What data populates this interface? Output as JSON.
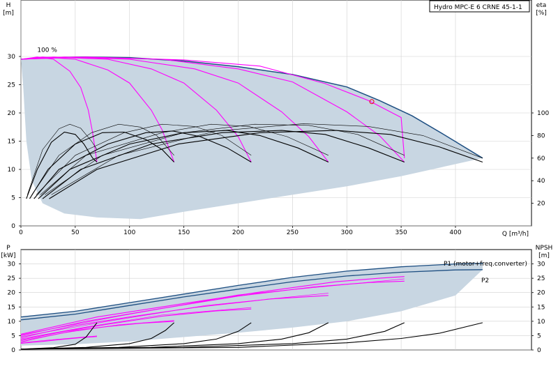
{
  "title": "Hydro MPC-E 6 CRNE 45-1-1",
  "colors": {
    "area_fill": "#c8d6e2",
    "envelope_line": "#1e4f82",
    "magenta": "#ff00ff",
    "black": "#000000",
    "marker": "#e8000b"
  },
  "chart_data": [
    {
      "type": "line",
      "id": "qh-panel",
      "xlabel": "Q [m³/h]",
      "ylabel": "H\n[m]",
      "y2label": "eta\n[%]",
      "xlim": [
        0,
        470
      ],
      "ylim": [
        0,
        40
      ],
      "y2lim": [
        0,
        200
      ],
      "xticks": [
        0,
        50,
        100,
        150,
        200,
        250,
        300,
        350,
        400
      ],
      "yticks": [
        0,
        5,
        10,
        15,
        20,
        25,
        30
      ],
      "y2ticks": [
        20,
        40,
        60,
        80,
        100
      ],
      "grid": true,
      "annotations": [
        {
          "text": "100 %",
          "x": 15,
          "y": 30.8
        }
      ],
      "marker_point": {
        "x": 323,
        "y": 22
      },
      "envelope_upper": [
        [
          0,
          29.5
        ],
        [
          20,
          29.8
        ],
        [
          60,
          29.9
        ],
        [
          100,
          29.8
        ],
        [
          150,
          29.2
        ],
        [
          200,
          28.2
        ],
        [
          250,
          26.8
        ],
        [
          300,
          24.6
        ],
        [
          330,
          22.2
        ],
        [
          360,
          19.5
        ],
        [
          390,
          16.1
        ],
        [
          425,
          12.0
        ]
      ],
      "envelope_lower_area": [
        [
          0,
          29.5
        ],
        [
          2,
          25
        ],
        [
          5,
          15
        ],
        [
          10,
          8
        ],
        [
          20,
          4
        ],
        [
          40,
          2.2
        ],
        [
          70,
          1.5
        ],
        [
          110,
          1.2
        ],
        [
          150,
          2.5
        ],
        [
          200,
          4
        ],
        [
          250,
          5.5
        ],
        [
          300,
          7
        ],
        [
          350,
          8.8
        ],
        [
          425,
          12.0
        ]
      ],
      "envelope_lower_h": [
        [
          0,
          29.5
        ],
        [
          15,
          30.0
        ],
        [
          60,
          29.9
        ],
        [
          100,
          29.7
        ],
        [
          150,
          29.0
        ],
        [
          200,
          27.8
        ],
        [
          250,
          26.2
        ],
        [
          300,
          23.8
        ],
        [
          350,
          20.2
        ],
        [
          390,
          16.0
        ],
        [
          425,
          11.8
        ]
      ],
      "head_curves": [
        [
          [
            0,
            29.5
          ],
          [
            15,
            29.9
          ],
          [
            30,
            29.5
          ],
          [
            45,
            27.4
          ],
          [
            55,
            24.5
          ],
          [
            62,
            20.5
          ],
          [
            66,
            16.5
          ],
          [
            70,
            11.3
          ]
        ],
        [
          [
            0,
            29.5
          ],
          [
            20,
            29.9
          ],
          [
            50,
            29.5
          ],
          [
            80,
            27.6
          ],
          [
            100,
            25.3
          ],
          [
            120,
            20.5
          ],
          [
            130,
            17.0
          ],
          [
            141,
            11.3
          ]
        ],
        [
          [
            0,
            29.5
          ],
          [
            30,
            29.9
          ],
          [
            80,
            29.5
          ],
          [
            120,
            27.8
          ],
          [
            150,
            25.3
          ],
          [
            180,
            20.5
          ],
          [
            200,
            15.8
          ],
          [
            212,
            11.3
          ]
        ],
        [
          [
            0,
            29.5
          ],
          [
            40,
            29.9
          ],
          [
            100,
            29.5
          ],
          [
            160,
            27.8
          ],
          [
            200,
            25.3
          ],
          [
            240,
            20.2
          ],
          [
            265,
            15.8
          ],
          [
            283,
            11.3
          ]
        ],
        [
          [
            0,
            29.5
          ],
          [
            50,
            29.9
          ],
          [
            130,
            29.5
          ],
          [
            200,
            27.8
          ],
          [
            250,
            25.5
          ],
          [
            300,
            20.2
          ],
          [
            330,
            16.0
          ],
          [
            353,
            11.3
          ]
        ],
        [
          [
            0,
            29.5
          ],
          [
            60,
            29.9
          ],
          [
            150,
            29.4
          ],
          [
            220,
            28.3
          ],
          [
            280,
            25.2
          ],
          [
            320,
            22.2
          ],
          [
            350,
            19.2
          ],
          [
            353,
            12.0
          ]
        ]
      ],
      "eta_curves": [
        [
          [
            5,
            4.8
          ],
          [
            15,
            10.0
          ],
          [
            28,
            14.8
          ],
          [
            40,
            16.6
          ],
          [
            50,
            16.2
          ],
          [
            58,
            14.5
          ],
          [
            66,
            12.0
          ],
          [
            70,
            11.3
          ]
        ],
        [
          [
            8,
            4.8
          ],
          [
            25,
            10.0
          ],
          [
            50,
            14.5
          ],
          [
            75,
            16.5
          ],
          [
            95,
            16.6
          ],
          [
            115,
            15.3
          ],
          [
            130,
            13.5
          ],
          [
            141,
            11.3
          ]
        ],
        [
          [
            12,
            4.8
          ],
          [
            35,
            10.0
          ],
          [
            80,
            14.5
          ],
          [
            115,
            16.5
          ],
          [
            140,
            16.8
          ],
          [
            165,
            15.8
          ],
          [
            190,
            13.8
          ],
          [
            212,
            11.3
          ]
        ],
        [
          [
            16,
            4.8
          ],
          [
            45,
            10.0
          ],
          [
            100,
            14.5
          ],
          [
            150,
            16.5
          ],
          [
            190,
            16.9
          ],
          [
            220,
            16.0
          ],
          [
            255,
            13.8
          ],
          [
            283,
            11.3
          ]
        ],
        [
          [
            20,
            4.8
          ],
          [
            55,
            10.0
          ],
          [
            120,
            14.5
          ],
          [
            185,
            16.5
          ],
          [
            240,
            16.9
          ],
          [
            280,
            16.2
          ],
          [
            320,
            13.8
          ],
          [
            353,
            11.3
          ]
        ],
        [
          [
            26,
            4.8
          ],
          [
            70,
            10.0
          ],
          [
            145,
            14.5
          ],
          [
            220,
            16.5
          ],
          [
            290,
            16.9
          ],
          [
            340,
            16.2
          ],
          [
            385,
            14.0
          ],
          [
            425,
            11.3
          ]
        ]
      ],
      "eta_thin_curves": [
        [
          [
            6,
            5.5
          ],
          [
            20,
            13.5
          ],
          [
            35,
            17.2
          ],
          [
            45,
            18.0
          ],
          [
            55,
            17.3
          ],
          [
            65,
            15.0
          ],
          [
            70,
            13.5
          ]
        ],
        [
          [
            10,
            5.5
          ],
          [
            35,
            12.5
          ],
          [
            65,
            16.5
          ],
          [
            90,
            18.0
          ],
          [
            110,
            17.5
          ],
          [
            125,
            16.0
          ],
          [
            141,
            12.5
          ]
        ],
        [
          [
            14,
            5.5
          ],
          [
            50,
            12.5
          ],
          [
            95,
            16.5
          ],
          [
            130,
            18.0
          ],
          [
            160,
            17.6
          ],
          [
            185,
            16.0
          ],
          [
            212,
            12.5
          ]
        ],
        [
          [
            18,
            5.5
          ],
          [
            60,
            12.5
          ],
          [
            130,
            16.5
          ],
          [
            175,
            18.0
          ],
          [
            210,
            17.6
          ],
          [
            245,
            15.8
          ],
          [
            283,
            12.5
          ]
        ],
        [
          [
            22,
            5.5
          ],
          [
            75,
            12.5
          ],
          [
            150,
            16.5
          ],
          [
            215,
            18.0
          ],
          [
            265,
            17.8
          ],
          [
            310,
            16.2
          ],
          [
            353,
            12.5
          ]
        ],
        [
          [
            28,
            5.5
          ],
          [
            90,
            12.5
          ],
          [
            180,
            16.8
          ],
          [
            260,
            18.1
          ],
          [
            320,
            17.6
          ],
          [
            370,
            16.0
          ],
          [
            425,
            12.0
          ]
        ]
      ]
    },
    {
      "type": "line",
      "id": "power-npsh-panel",
      "ylabel": "P\n[kW]",
      "y2label": "NPSH\n[m]",
      "xlim": [
        0,
        470
      ],
      "ylim": [
        0,
        35
      ],
      "yticks": [
        0,
        5,
        10,
        15,
        20,
        25,
        30
      ],
      "y2ticks": [
        0,
        5,
        10,
        15,
        20,
        25,
        30
      ],
      "grid": true,
      "series": [
        {
          "name": "P1 (motor+freq.converter)",
          "values": [
            [
              0,
              11.5
            ],
            [
              50,
              13.5
            ],
            [
              100,
              16.5
            ],
            [
              150,
              19.5
            ],
            [
              200,
              22.5
            ],
            [
              250,
              25.3
            ],
            [
              300,
              27.5
            ],
            [
              350,
              29.0
            ],
            [
              400,
              30.0
            ],
            [
              425,
              30.2
            ]
          ]
        },
        {
          "name": "P2",
          "values": [
            [
              0,
              10.5
            ],
            [
              50,
              12.5
            ],
            [
              100,
              15.5
            ],
            [
              150,
              18.5
            ],
            [
              200,
              21.2
            ],
            [
              250,
              23.8
            ],
            [
              300,
              25.8
            ],
            [
              350,
              27.1
            ],
            [
              400,
              27.9
            ],
            [
              425,
              28.0
            ]
          ]
        }
      ],
      "area_lower": [
        [
          0,
          1.5
        ],
        [
          50,
          2.0
        ],
        [
          100,
          3.0
        ],
        [
          150,
          4.5
        ],
        [
          200,
          6.0
        ],
        [
          250,
          7.8
        ],
        [
          300,
          10.0
        ],
        [
          350,
          13.5
        ],
        [
          400,
          19.0
        ],
        [
          425,
          28.0
        ]
      ],
      "power_curves": [
        [
          [
            0,
            2.3
          ],
          [
            20,
            3.0
          ],
          [
            40,
            3.8
          ],
          [
            55,
            4.3
          ],
          [
            70,
            4.7
          ]
        ],
        [
          [
            0,
            2.8
          ],
          [
            20,
            4.5
          ],
          [
            50,
            6.8
          ],
          [
            80,
            8.2
          ],
          [
            110,
            9.3
          ],
          [
            141,
            10.0
          ]
        ],
        [
          [
            0,
            3.5
          ],
          [
            40,
            6.5
          ],
          [
            80,
            9.0
          ],
          [
            130,
            11.8
          ],
          [
            180,
            13.6
          ],
          [
            212,
            14.3
          ]
        ],
        [
          [
            0,
            4.3
          ],
          [
            50,
            8.5
          ],
          [
            100,
            11.5
          ],
          [
            160,
            14.8
          ],
          [
            230,
            17.8
          ],
          [
            283,
            19.0
          ]
        ],
        [
          [
            0,
            5.0
          ],
          [
            60,
            10.0
          ],
          [
            130,
            14.5
          ],
          [
            200,
            18.8
          ],
          [
            270,
            22.0
          ],
          [
            320,
            23.5
          ],
          [
            353,
            24.0
          ]
        ],
        [
          [
            0,
            5.5
          ],
          [
            70,
            11.5
          ],
          [
            150,
            16.2
          ],
          [
            220,
            20.2
          ],
          [
            290,
            23.8
          ],
          [
            330,
            25.0
          ],
          [
            353,
            25.6
          ]
        ]
      ],
      "power_thin_curves": [
        [
          [
            0,
            2.6
          ],
          [
            30,
            3.6
          ],
          [
            60,
            4.6
          ],
          [
            70,
            4.9
          ]
        ],
        [
          [
            0,
            3.2
          ],
          [
            40,
            6.0
          ],
          [
            90,
            8.8
          ],
          [
            141,
            10.3
          ]
        ],
        [
          [
            0,
            3.9
          ],
          [
            60,
            8.0
          ],
          [
            130,
            12.2
          ],
          [
            212,
            14.8
          ]
        ],
        [
          [
            0,
            4.7
          ],
          [
            80,
            10.0
          ],
          [
            170,
            15.5
          ],
          [
            283,
            19.8
          ]
        ],
        [
          [
            0,
            5.3
          ],
          [
            90,
            11.8
          ],
          [
            200,
            19.2
          ],
          [
            353,
            24.8
          ]
        ]
      ],
      "npsh_curves": [
        [
          [
            0,
            0.3
          ],
          [
            30,
            0.8
          ],
          [
            50,
            2.0
          ],
          [
            60,
            4.5
          ],
          [
            66,
            7.5
          ],
          [
            70,
            9.5
          ]
        ],
        [
          [
            0,
            0.3
          ],
          [
            60,
            0.9
          ],
          [
            100,
            2.2
          ],
          [
            120,
            4.0
          ],
          [
            133,
            6.8
          ],
          [
            141,
            9.5
          ]
        ],
        [
          [
            0,
            0.3
          ],
          [
            90,
            0.9
          ],
          [
            150,
            2.2
          ],
          [
            180,
            3.8
          ],
          [
            200,
            6.5
          ],
          [
            212,
            9.5
          ]
        ],
        [
          [
            0,
            0.3
          ],
          [
            120,
            0.9
          ],
          [
            200,
            2.2
          ],
          [
            240,
            3.8
          ],
          [
            265,
            6.0
          ],
          [
            283,
            9.5
          ]
        ],
        [
          [
            0,
            0.3
          ],
          [
            150,
            0.9
          ],
          [
            250,
            2.2
          ],
          [
            300,
            3.8
          ],
          [
            335,
            6.5
          ],
          [
            353,
            9.5
          ]
        ],
        [
          [
            0,
            0.3
          ],
          [
            200,
            0.9
          ],
          [
            300,
            2.5
          ],
          [
            350,
            4.0
          ],
          [
            385,
            5.8
          ],
          [
            425,
            9.5
          ]
        ]
      ]
    }
  ]
}
